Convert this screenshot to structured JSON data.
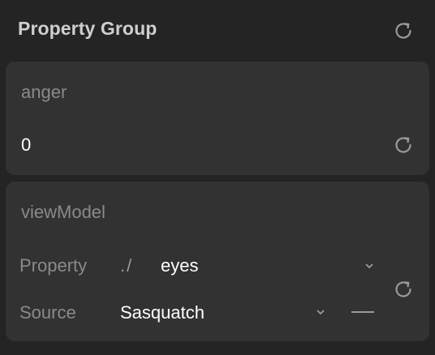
{
  "header": {
    "title": "Property Group",
    "reset_icon": "reset-icon"
  },
  "anger": {
    "label": "anger",
    "value": "0",
    "reset_icon": "reset-icon"
  },
  "view_model": {
    "label": "viewModel",
    "property": {
      "label": "Property",
      "prefix": "./",
      "value": "eyes",
      "dropdown_icon": "chevron-down-icon"
    },
    "source": {
      "label": "Source",
      "value": "Sasquatch",
      "dropdown_icon": "chevron-down-icon",
      "unset_icon": "dash-icon"
    },
    "reset_icon": "reset-icon"
  },
  "colors": {
    "panel_bg": "#242424",
    "card_bg": "#323232",
    "label_gray": "#8a8a8a",
    "value_white": "#ffffff"
  }
}
